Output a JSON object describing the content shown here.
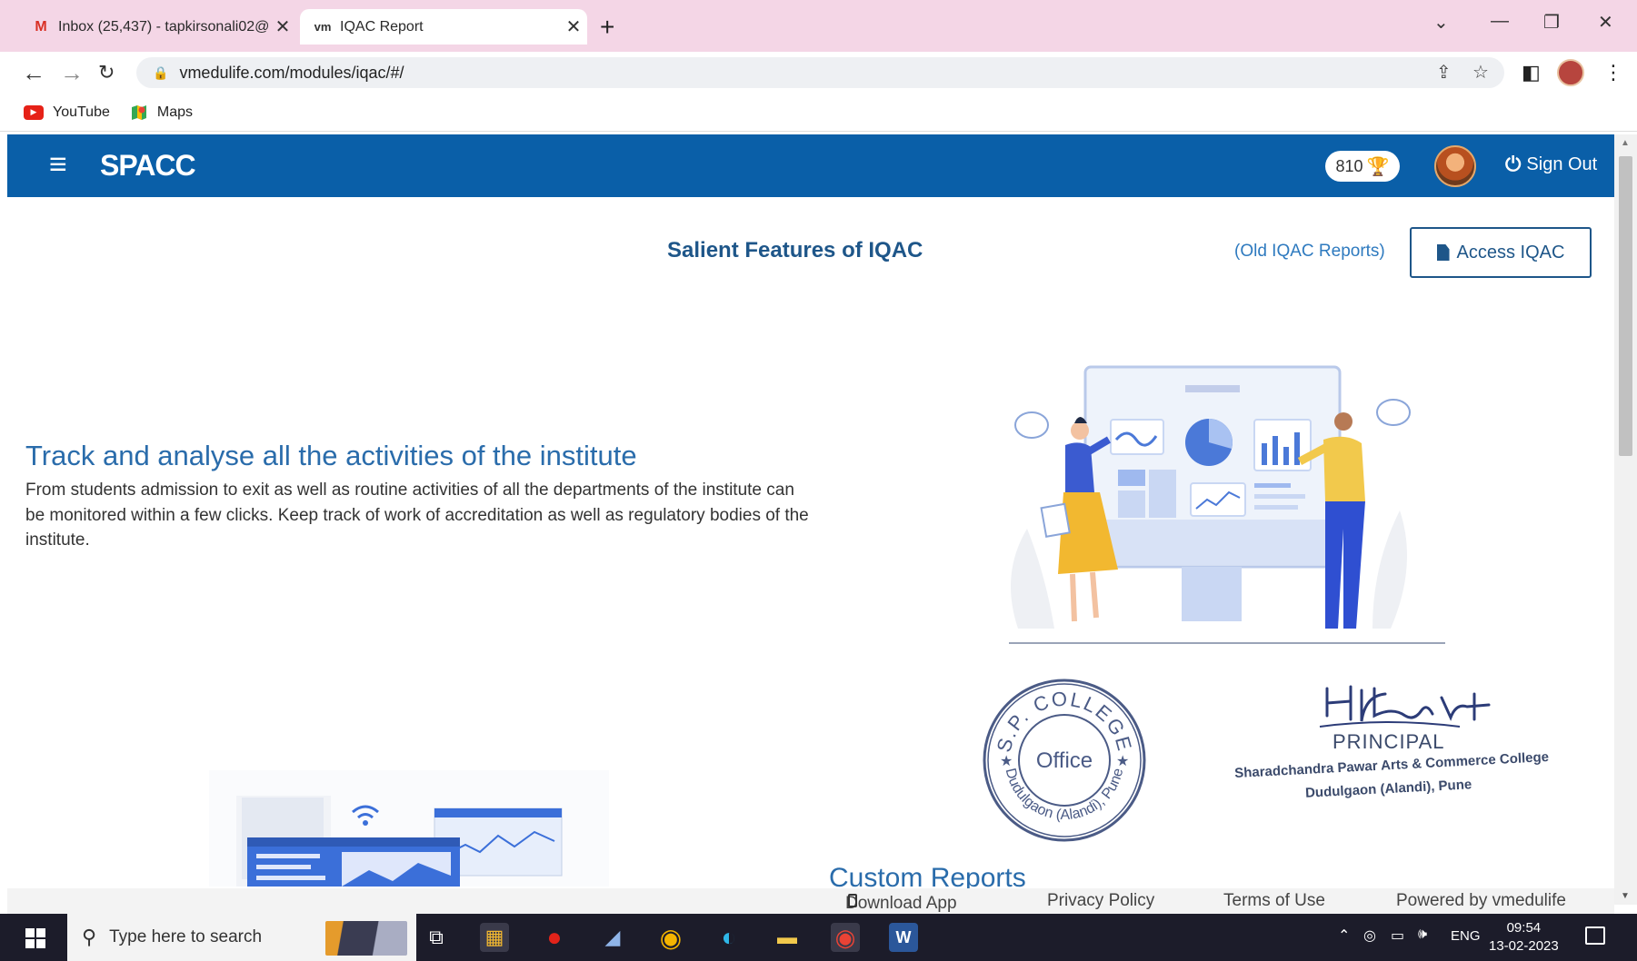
{
  "browser": {
    "tabs": [
      {
        "label": "Inbox (25,437) - tapkirsonali02@",
        "favicon": "M",
        "active": false
      },
      {
        "label": "IQAC Report",
        "favicon": "vm",
        "active": true
      }
    ],
    "new_tab": "+",
    "url": "vmedulife.com/modules/iqac/#/",
    "bookmarks": [
      {
        "label": "YouTube",
        "icon": "youtube-icon"
      },
      {
        "label": "Maps",
        "icon": "maps-icon"
      }
    ]
  },
  "app": {
    "brand": "SPACC",
    "points": "810",
    "sign_out": "Sign Out"
  },
  "page": {
    "section_title": "Salient Features of IQAC",
    "old_reports_link": "(Old IQAC Reports)",
    "access_button": "Access IQAC",
    "feature_title": "Track and analyse all the activities of the institute",
    "feature_desc": "From students admission to exit as well as routine activities of all the departments of the institute can be monitored within a few clicks. Keep track of work of accreditation as well as regulatory bodies of the institute.",
    "custom_reports": "Custom Reports"
  },
  "stamp": {
    "top_text": "S.P. COLLEGE",
    "center_text": "Office",
    "bottom_text": "Dudulgaon (Alandi), Pune"
  },
  "signature": {
    "title": "PRINCIPAL",
    "line1": "Sharadchandra Pawar Arts & Commerce College",
    "line2": "Dudulgaon (Alandi), Pune"
  },
  "footer": {
    "download_app": "Download App",
    "privacy": "Privacy Policy",
    "terms": "Terms of Use",
    "powered": "Powered by vmedulife"
  },
  "taskbar": {
    "search_placeholder": "Type here to search",
    "language": "ENG",
    "time": "09:54",
    "date": "13-02-2023"
  },
  "colors": {
    "app_header": "#0a5fa8",
    "accent_text": "#2a6cab",
    "tabstrip": "#f4d6e6"
  }
}
